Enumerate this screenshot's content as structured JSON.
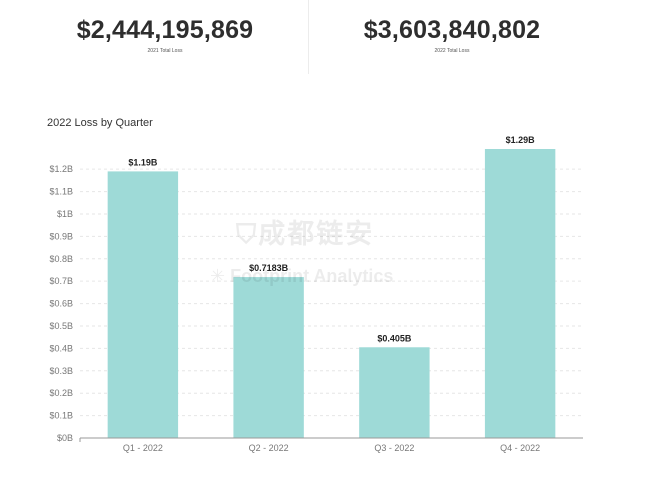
{
  "kpis": [
    {
      "value": "$2,444,195,869",
      "label": "2021 Total Loss"
    },
    {
      "value": "$3,603,840,802",
      "label": "2022 Total Loss"
    }
  ],
  "watermark": {
    "chinese": "成都链安",
    "english": "Footprint Analytics",
    "icon": "shield-logo-icon"
  },
  "chart_data": {
    "type": "bar",
    "title": "2022 Loss by Quarter",
    "categories": [
      "Q1 - 2022",
      "Q2 - 2022",
      "Q3 - 2022",
      "Q4 - 2022"
    ],
    "values": [
      1.19,
      0.7183,
      0.405,
      1.29
    ],
    "value_unit": "billion USD",
    "data_labels": [
      "$1.19B",
      "$0.7183B",
      "$0.405B",
      "$1.29B"
    ],
    "y_ticks": [
      0,
      0.1,
      0.2,
      0.3,
      0.4,
      0.5,
      0.6,
      0.7,
      0.8,
      0.9,
      1.0,
      1.1,
      1.2
    ],
    "y_tick_labels": [
      "$0B",
      "$0.1B",
      "$0.2B",
      "$0.3B",
      "$0.4B",
      "$0.5B",
      "$0.6B",
      "$0.7B",
      "$0.8B",
      "$0.9B",
      "$1B",
      "$1.1B",
      "$1.2B"
    ],
    "ylim": [
      0,
      1.29
    ],
    "xlabel": "",
    "ylabel": "",
    "grid": true,
    "legend": "none",
    "colors": {
      "bar": "#9edad7",
      "grid": "#e6e6e6",
      "axis": "#999999",
      "tick_text": "#777777",
      "label_text": "#222222"
    }
  }
}
